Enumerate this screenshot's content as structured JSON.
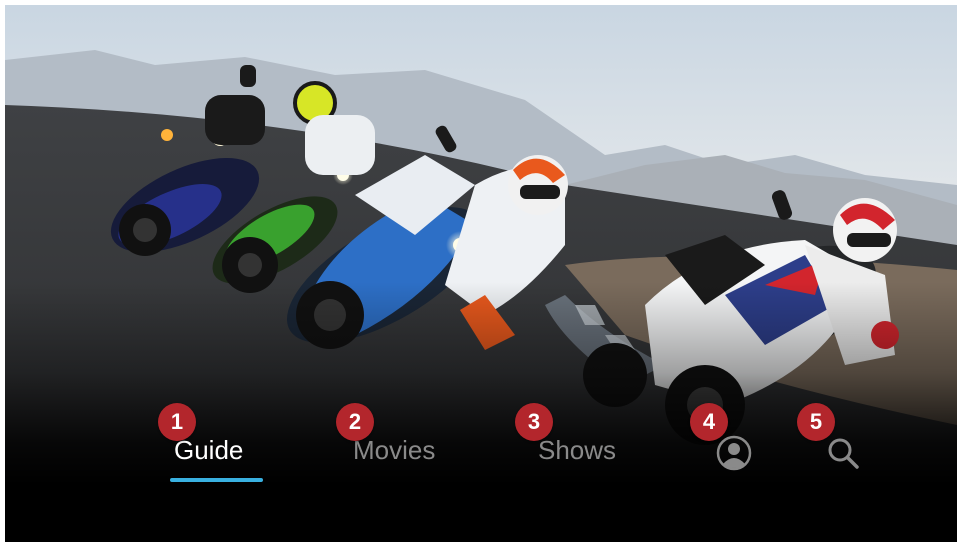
{
  "nav": {
    "items": [
      {
        "label": "Guide",
        "badge": "1",
        "active": true
      },
      {
        "label": "Movies",
        "badge": "2",
        "active": false
      },
      {
        "label": "Shows",
        "badge": "3",
        "active": false
      }
    ],
    "profile": {
      "badge": "4",
      "icon": "profile-icon"
    },
    "search": {
      "badge": "5",
      "icon": "search-icon"
    }
  },
  "colors": {
    "badge": "#b3262c",
    "active_underline": "#39b0e0",
    "active_text": "#ffffff",
    "inactive_text": "#8a8a8a"
  },
  "hero": {
    "description": "Motorcycle racers leaning into a track corner"
  }
}
